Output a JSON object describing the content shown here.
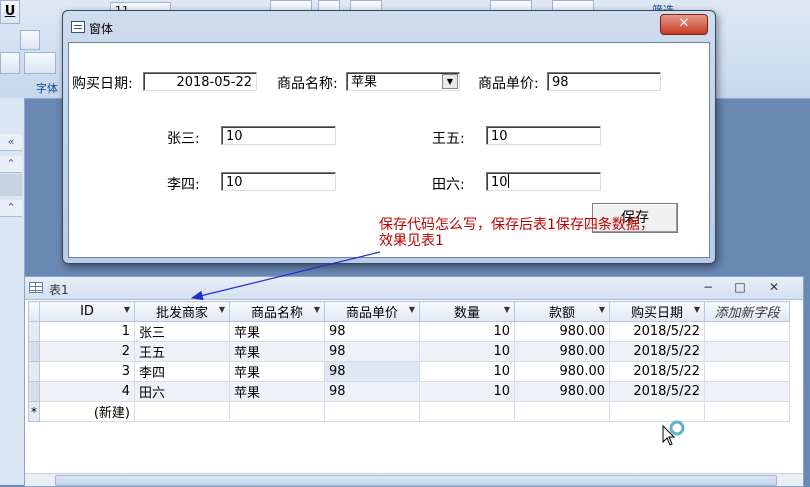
{
  "ribbon": {
    "font_group_label": "字体",
    "font_size_value": "11",
    "filter_label": "筛选",
    "bold_glyph": "U"
  },
  "nav": {
    "collapse": "«",
    "up1": "⌃",
    "up2": "⌃"
  },
  "dialog": {
    "title": "窗体",
    "close": "✕",
    "date_label": "购买日期:",
    "date_value": "2018-05-22",
    "product_label": "商品名称:",
    "product_value": "苹果",
    "price_label": "商品单价:",
    "price_value": "98",
    "zhangsan_label": "张三:",
    "zhangsan_value": "10",
    "wangwu_label": "王五:",
    "wangwu_value": "10",
    "lisi_label": "李四:",
    "lisi_value": "10",
    "tianliu_label": "田六:",
    "tianliu_value": "10",
    "save_label": "保存"
  },
  "annotation": {
    "line1": "保存代码怎么写，保存后表1保存四条数据，",
    "line2": "效果见表1"
  },
  "sheet": {
    "title": "表1",
    "min": "−",
    "max": "□",
    "close": "✕",
    "columns": [
      "ID",
      "批发商家",
      "商品名称",
      "商品单价",
      "数量",
      "款额",
      "购买日期",
      "添加新字段"
    ],
    "rows": [
      {
        "id": "1",
        "dealer": "张三",
        "product": "苹果",
        "price": "98",
        "qty": "10",
        "amount": "980.00",
        "date": "2018/5/22"
      },
      {
        "id": "2",
        "dealer": "王五",
        "product": "苹果",
        "price": "98",
        "qty": "10",
        "amount": "980.00",
        "date": "2018/5/22"
      },
      {
        "id": "3",
        "dealer": "李四",
        "product": "苹果",
        "price": "98",
        "qty": "10",
        "amount": "980.00",
        "date": "2018/5/22"
      },
      {
        "id": "4",
        "dealer": "田六",
        "product": "苹果",
        "price": "98",
        "qty": "10",
        "amount": "980.00",
        "date": "2018/5/22"
      }
    ],
    "new_row_marker": "*",
    "new_row_label": "(新建)"
  }
}
